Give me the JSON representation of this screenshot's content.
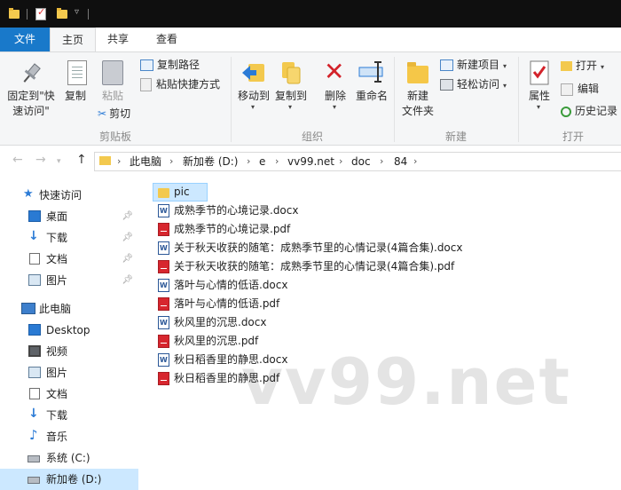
{
  "quick_access_toolbar": {
    "icons": [
      "folder-icon",
      "properties-icon",
      "new-folder-icon",
      "customize-arrow-icon"
    ]
  },
  "ribbon": {
    "tabs": {
      "file": "文件",
      "home": "主页",
      "share": "共享",
      "view": "查看"
    },
    "clipboard": {
      "pin_line1": "固定到\"快",
      "pin_line2": "速访问\"",
      "copy": "复制",
      "paste": "粘贴",
      "copy_path": "复制路径",
      "paste_shortcut": "粘贴快捷方式",
      "cut": "剪切",
      "group": "剪贴板"
    },
    "organize": {
      "move_to": "移动到",
      "copy_to": "复制到",
      "delete": "删除",
      "rename": "重命名",
      "group": "组织"
    },
    "new": {
      "new_folder_line1": "新建",
      "new_folder_line2": "文件夹",
      "new_item": "新建项目",
      "easy_access": "轻松访问",
      "group": "新建"
    },
    "open": {
      "properties": "属性",
      "open": "打开",
      "edit": "编辑",
      "history": "历史记录",
      "group": "打开"
    }
  },
  "address_bar": {
    "crumbs": [
      "此电脑",
      "新加卷 (D:)",
      "e",
      "vv99.net",
      "doc",
      "84"
    ]
  },
  "nav_pane": {
    "quick_access": "快速访问",
    "quick_items": [
      "桌面",
      "下载",
      "文档",
      "图片"
    ],
    "this_pc": "此电脑",
    "pc_items": [
      "Desktop",
      "视频",
      "图片",
      "文档",
      "下载",
      "音乐",
      "系统 (C:)",
      "新加卷 (D:)"
    ]
  },
  "files": [
    {
      "name": "pic",
      "type": "folder"
    },
    {
      "name": "成熟季节的心境记录.docx",
      "type": "docx"
    },
    {
      "name": "成熟季节的心境记录.pdf",
      "type": "pdf"
    },
    {
      "name": "关于秋天收获的随笔：成熟季节里的心情记录(4篇合集).docx",
      "type": "docx"
    },
    {
      "name": "关于秋天收获的随笔：成熟季节里的心情记录(4篇合集).pdf",
      "type": "pdf"
    },
    {
      "name": "落叶与心情的低语.docx",
      "type": "docx"
    },
    {
      "name": "落叶与心情的低语.pdf",
      "type": "pdf"
    },
    {
      "name": "秋风里的沉思.docx",
      "type": "docx"
    },
    {
      "name": "秋风里的沉思.pdf",
      "type": "pdf"
    },
    {
      "name": "秋日稻香里的静思.docx",
      "type": "docx"
    },
    {
      "name": "秋日稻香里的静思.pdf",
      "type": "pdf"
    }
  ],
  "watermark": "vv99.net",
  "colors": {
    "accent": "#1979ca",
    "selection": "#cce8ff",
    "folder": "#f3c94e",
    "pdf": "#d7262e",
    "docx": "#2b5797"
  }
}
